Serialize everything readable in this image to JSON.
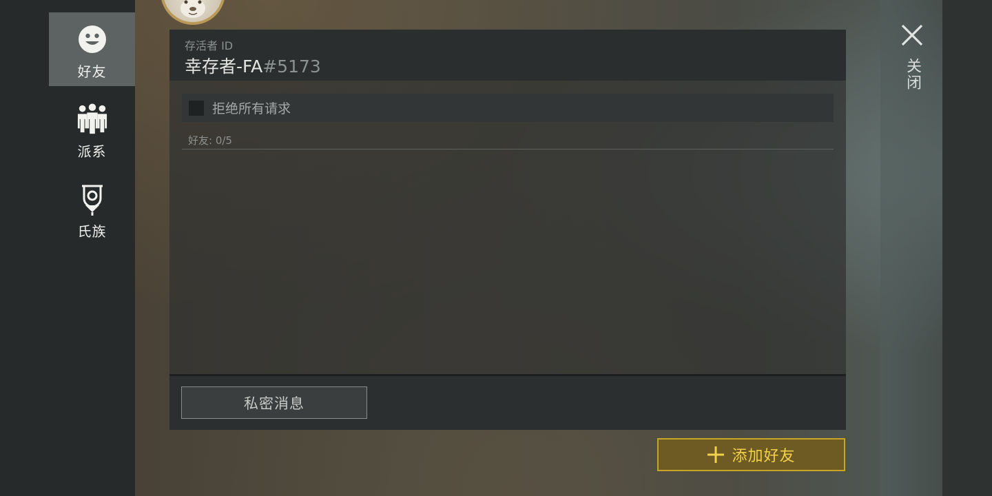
{
  "sidebar": {
    "items": [
      {
        "label": "好友",
        "icon": "smiley-icon",
        "active": true
      },
      {
        "label": "派系",
        "icon": "group-icon",
        "active": false
      },
      {
        "label": "氏族",
        "icon": "clan-banner-icon",
        "active": false
      }
    ]
  },
  "profile": {
    "id_label": "存活者 ID",
    "name": "幸存者-FA",
    "tag": "#5173"
  },
  "friends": {
    "reject_all_label": "拒绝所有请求",
    "reject_all_checked": false,
    "count_label": "好友: 0/5"
  },
  "actions": {
    "private_message_label": "私密消息",
    "add_friend_label": "添加好友",
    "close_label": "关闭"
  },
  "colors": {
    "accent_gold": "#f2d24a",
    "active_tab": "#5d6263"
  }
}
